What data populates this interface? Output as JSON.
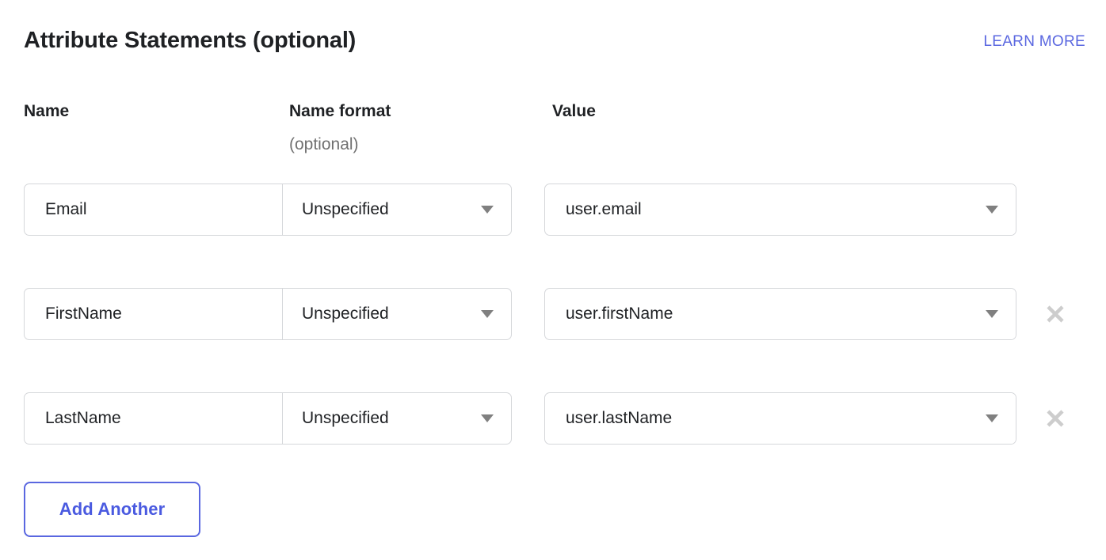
{
  "section": {
    "title": "Attribute Statements (optional)",
    "learn_more_label": "LEARN MORE",
    "learn_more_color": "#5a67e0"
  },
  "columns": {
    "name_label": "Name",
    "name_format_label": "Name format",
    "name_format_sublabel": "(optional)",
    "value_label": "Value"
  },
  "rows": [
    {
      "name": "Email",
      "name_format": "Unspecified",
      "value": "user.email",
      "removable": false
    },
    {
      "name": "FirstName",
      "name_format": "Unspecified",
      "value": "user.firstName",
      "removable": true
    },
    {
      "name": "LastName",
      "name_format": "Unspecified",
      "value": "user.lastName",
      "removable": true
    }
  ],
  "actions": {
    "add_another_label": "Add Another",
    "add_another_color": "#4a5ae0"
  },
  "icons": {
    "caret": "chevron-down-icon",
    "remove": "close-icon"
  }
}
